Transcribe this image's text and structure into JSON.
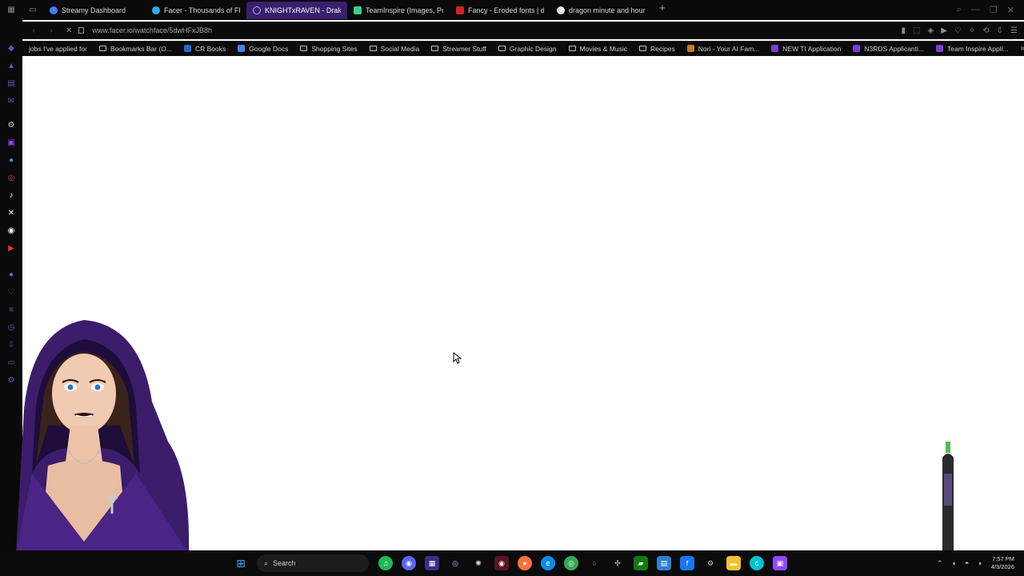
{
  "tabs": [
    {
      "label": "Streamy Dashboard",
      "color": "#4a7cff",
      "active": false
    },
    {
      "label": "Facer - Thousands of FRE",
      "color": "#2bb0e8",
      "active": false
    },
    {
      "label": "KNIGHTxRAVEN - Draken",
      "color": "#6c3fb5",
      "active": true
    },
    {
      "label": "TeamInspire (Images, Po",
      "color": "#3ad18b",
      "active": false
    },
    {
      "label": "Fancy - Eroded fonts | da",
      "color": "#d02424",
      "active": false
    },
    {
      "label": "dragon minute and hour h",
      "color": "#e8e8e8",
      "active": false
    }
  ],
  "address": {
    "url": "www.facer.io/watchface/5dwHFxJB8h"
  },
  "bookmarks": [
    {
      "label": "jobs I've applied for",
      "kind": "none"
    },
    {
      "label": "Bookmarks Bar (O...",
      "kind": "folder"
    },
    {
      "label": "CR Books",
      "kind": "icon",
      "color": "#1c6dd0"
    },
    {
      "label": "Google Docs",
      "kind": "icon",
      "color": "#4285f4"
    },
    {
      "label": "Shopping Sites",
      "kind": "folder"
    },
    {
      "label": "Social Media",
      "kind": "folder"
    },
    {
      "label": "Streamer Stuff",
      "kind": "folder"
    },
    {
      "label": "Graphic Design",
      "kind": "folder"
    },
    {
      "label": "Movies & Music",
      "kind": "folder"
    },
    {
      "label": "Recipes",
      "kind": "folder"
    },
    {
      "label": "Nori - Your AI Fam...",
      "kind": "icon",
      "color": "#c47a20"
    },
    {
      "label": "NEW TI Application",
      "kind": "icon",
      "color": "#7a3fd0"
    },
    {
      "label": "N3RDS Applicanti...",
      "kind": "icon",
      "color": "#7a3fd0"
    },
    {
      "label": "Team Inspire Appli...",
      "kind": "icon",
      "color": "#7a3fd0"
    }
  ],
  "taskbar": {
    "search_label": "Search"
  },
  "clock": {
    "time": "7:57 PM",
    "date": "4/3/2026"
  },
  "colors": {
    "accent": "#6c3fb5",
    "chrome": "#0a0a0a"
  }
}
